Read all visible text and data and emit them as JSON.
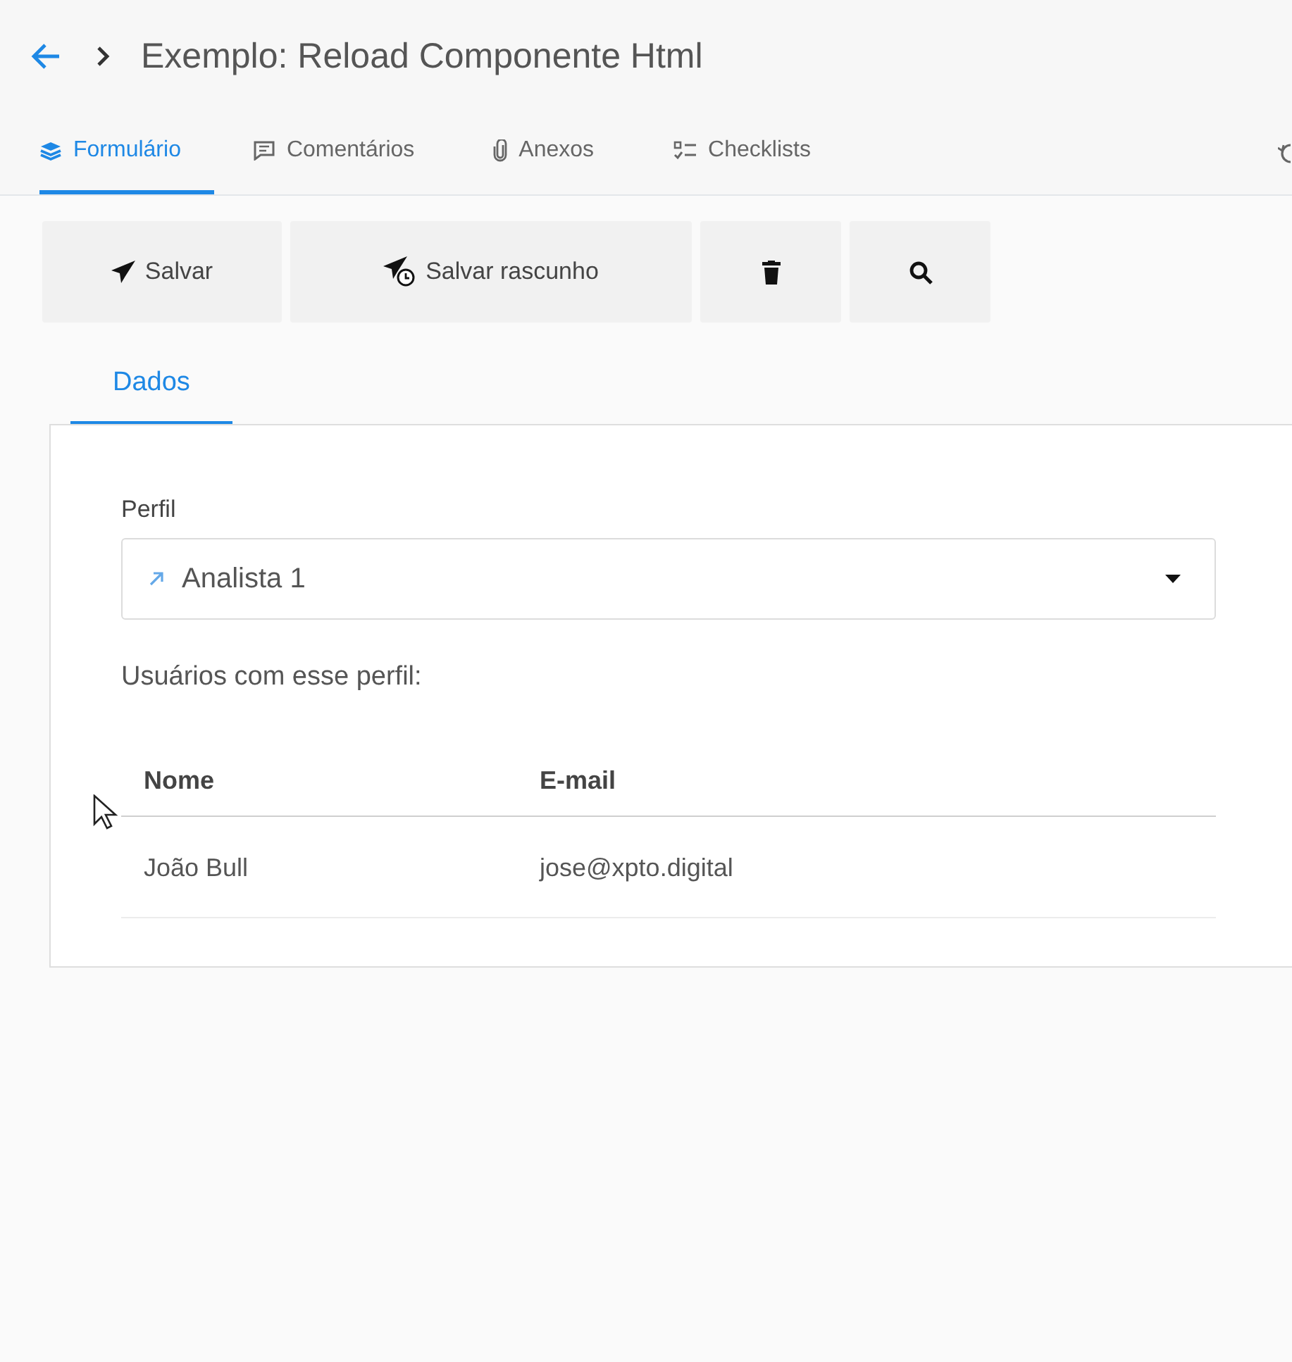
{
  "header": {
    "title": "Exemplo: Reload Componente Html"
  },
  "tabs": [
    {
      "label": "Formulário",
      "kind": "layers",
      "selected": true
    },
    {
      "label": "Comentários",
      "kind": "comment",
      "selected": false
    },
    {
      "label": "Anexos",
      "kind": "clip",
      "selected": false
    },
    {
      "label": "Checklists",
      "kind": "checklist",
      "selected": false
    }
  ],
  "toolbar": [
    {
      "kind": "send",
      "label": "Salvar"
    },
    {
      "kind": "draft",
      "label": "Salvar rascunho"
    },
    {
      "kind": "delete"
    },
    {
      "kind": "search"
    }
  ],
  "section_tabs": [
    {
      "label": "Dados",
      "selected": true
    }
  ],
  "form": {
    "label": "Perfil",
    "value": "Analista 1",
    "note": "Usuários com esse perfil:"
  },
  "table": {
    "columns": [
      "Nome",
      "E-mail"
    ],
    "rows": [
      [
        "João Bull",
        "jose@xpto.digital"
      ]
    ]
  }
}
